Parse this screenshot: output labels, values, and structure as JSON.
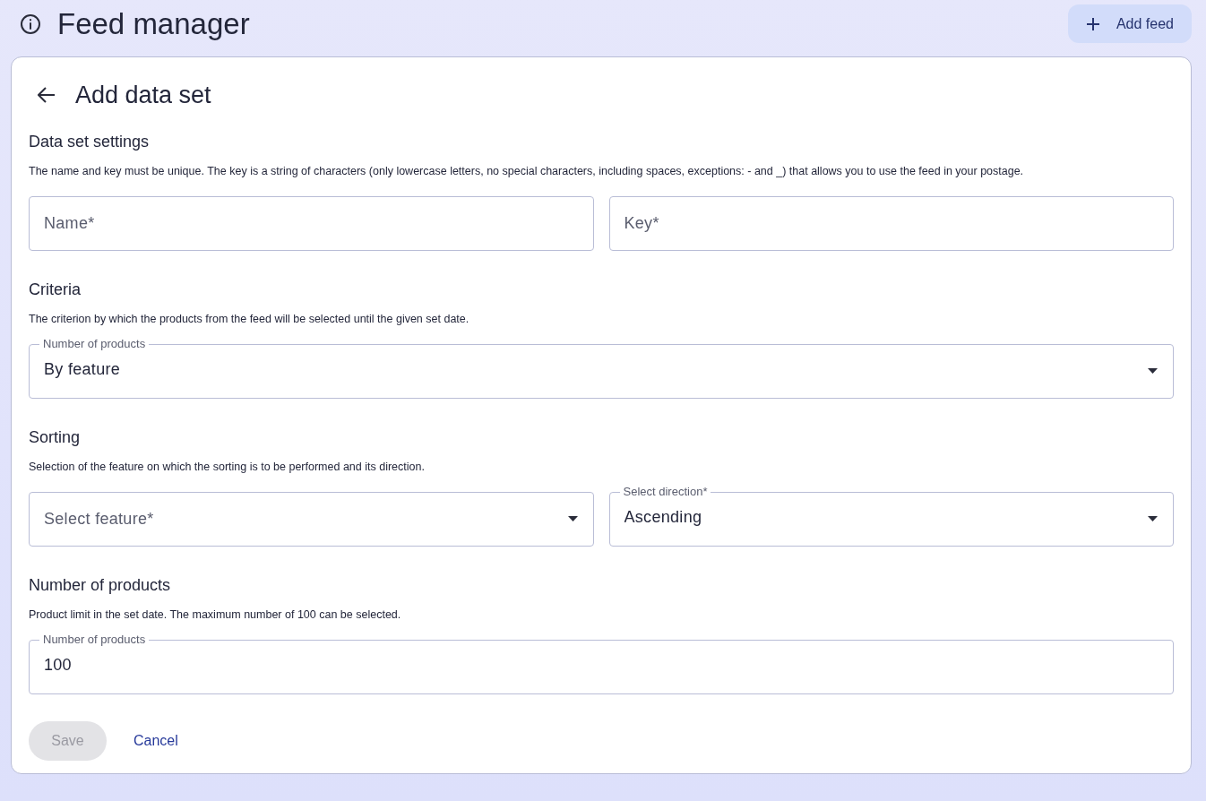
{
  "header": {
    "title": "Feed manager",
    "add_button": "Add feed"
  },
  "card": {
    "title": "Add data set",
    "sections": [
      {
        "title": "Data set settings",
        "description": "The name and key must be unique. The key is a string of characters (only lowercase letters, no special characters, including spaces, exceptions: - and _) that allows you to use the feed in your postage.",
        "fields": [
          {
            "kind": "text",
            "placeholder": "Name*"
          },
          {
            "kind": "text",
            "placeholder": "Key*"
          }
        ]
      },
      {
        "title": "Criteria",
        "description": "The criterion by which the products from the feed will be selected until the given set date.",
        "fields": [
          {
            "kind": "select",
            "label": "Number of products",
            "value": "By feature"
          }
        ]
      },
      {
        "title": "Sorting",
        "description": "Selection of the feature on which the sorting is to be performed and its direction.",
        "fields": [
          {
            "kind": "select",
            "placeholder": "Select feature*"
          },
          {
            "kind": "select",
            "label": "Select direction*",
            "value": "Ascending"
          }
        ]
      },
      {
        "title": "Number of products",
        "description": "Product limit in the set date. The maximum number of 100 can be selected.",
        "fields": [
          {
            "kind": "text",
            "label": "Number of products",
            "value": "100"
          }
        ]
      }
    ],
    "save_button": {
      "label": "Save",
      "disabled": true
    },
    "cancel_link": "Cancel"
  }
}
